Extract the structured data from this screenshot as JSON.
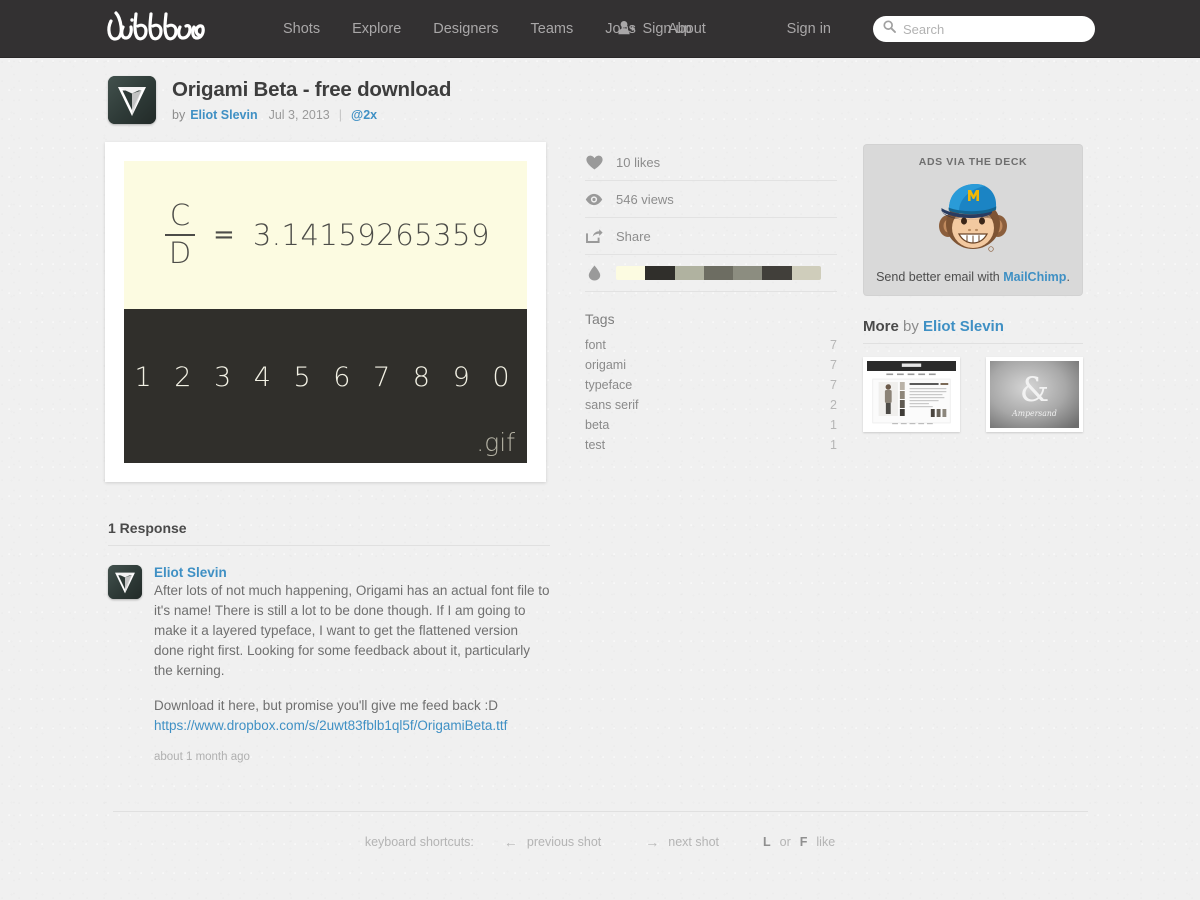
{
  "header": {
    "logo_text": "dribbble",
    "nav": [
      {
        "label": "Shots"
      },
      {
        "label": "Explore"
      },
      {
        "label": "Designers"
      },
      {
        "label": "Teams"
      },
      {
        "label": "Jobs"
      },
      {
        "label": "About"
      }
    ],
    "signup_label": "Sign up",
    "signin_label": "Sign in",
    "search_placeholder": "Search",
    "search_value": "",
    "background": "#333132"
  },
  "shot": {
    "title": "Origami Beta - free download",
    "by_label": "by",
    "author": "Eliot Slevin",
    "date": "Jul 3, 2013",
    "separator": "|",
    "resolution_badge": "@2x",
    "image": {
      "fraction_numerator": "C",
      "fraction_denominator": "D",
      "equals": "=",
      "pi_value": "3.14159265359",
      "numerals": "1234567890",
      "format_label": ".gif",
      "top_background": "#fcfbe1",
      "bottom_background": "#302f2b"
    }
  },
  "stats": {
    "likes": "10 likes",
    "views": "546 views",
    "share": "Share",
    "palette": [
      "#fcfbe1",
      "#302f2b",
      "#b0b2a0",
      "#6d6d62",
      "#8c8d80",
      "#413f3a",
      "#cfcdbb"
    ]
  },
  "tags": {
    "heading": "Tags",
    "items": [
      {
        "name": "font",
        "count": "7"
      },
      {
        "name": "origami",
        "count": "7"
      },
      {
        "name": "typeface",
        "count": "7"
      },
      {
        "name": "sans serif",
        "count": "2"
      },
      {
        "name": "beta",
        "count": "1"
      },
      {
        "name": "test",
        "count": "1"
      }
    ]
  },
  "ad": {
    "kicker": "ADS VIA THE DECK",
    "caption_prefix": "Send better email with ",
    "brand": "MailChimp",
    "caption_suffix": "."
  },
  "more": {
    "heading_bold": "More",
    "heading_by": " by ",
    "author": "Eliot Slevin",
    "thumbnails": [
      {
        "name": "website-mockup-shot"
      },
      {
        "name": "ampersand-shot",
        "label": "Ampersand",
        "glyph": "&"
      }
    ]
  },
  "responses": {
    "heading": "1 Response",
    "comment": {
      "author": "Eliot Slevin",
      "paragraph_1": "After lots of not much happening, Origami has an actual font file to it's name! There is still a lot to be done though. If I am going to make it a layered typeface, I want to get the flattened version done right first. Looking for some feedback about it, particularly the kerning.",
      "paragraph_2": "Download it here, but promise you'll give me feed back :D",
      "link_text": "https://www.dropbox.com/s/2uwt83fblb1ql5f/OrigamiBeta.ttf",
      "timestamp": "about 1 month ago"
    }
  },
  "footer": {
    "label": "keyboard shortcuts:",
    "shortcuts": [
      {
        "key": "←",
        "label": "previous shot"
      },
      {
        "key": "→",
        "label": "next shot"
      }
    ],
    "like_key_1": "L",
    "like_or": "or",
    "like_key_2": "F",
    "like_label": "like"
  }
}
